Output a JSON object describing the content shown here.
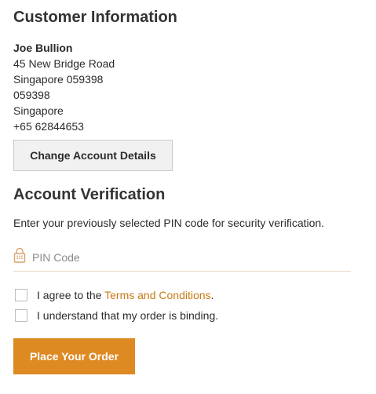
{
  "customer_section": {
    "title": "Customer Information",
    "name": "Joe Bullion",
    "address_line1": "45 New Bridge Road",
    "address_line2": "Singapore 059398",
    "postal_code": "059398",
    "country": "Singapore",
    "phone": "+65 62844653",
    "change_button_label": "Change Account Details"
  },
  "verification_section": {
    "title": "Account Verification",
    "description": "Enter your previously selected PIN code for security verification.",
    "pin_placeholder": "PIN Code",
    "pin_value": "",
    "pin_icon": "lock-keypad-icon"
  },
  "agreements": {
    "terms_prefix": "I agree to the ",
    "terms_link": "Terms and Conditions",
    "terms_suffix": ".",
    "binding_label": "I understand that my order is binding."
  },
  "order_button_label": "Place Your Order",
  "colors": {
    "accent": "#dd8a23",
    "link": "#c47a14",
    "underline": "#e8d6bc",
    "icon": "#d9a36b"
  }
}
